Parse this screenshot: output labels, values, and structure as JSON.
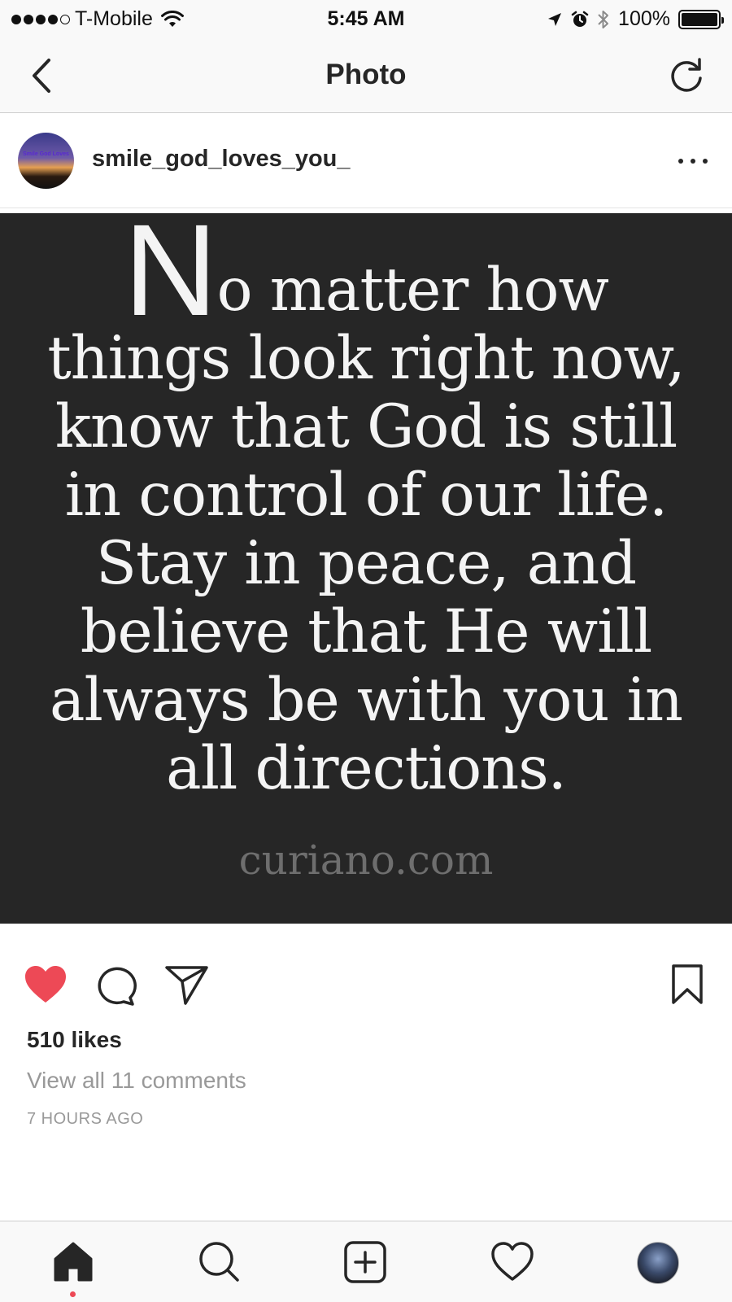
{
  "status_bar": {
    "carrier": "T-Mobile",
    "time": "5:45 AM",
    "battery_text": "100%",
    "battery_level": 1.0,
    "signal_bars_filled": 4,
    "signal_bars_total": 5,
    "icons": [
      "wifi-icon",
      "location-arrow-icon",
      "alarm-icon",
      "bluetooth-icon",
      "battery-icon"
    ]
  },
  "nav": {
    "title": "Photo",
    "back_icon": "chevron-left-icon",
    "refresh_icon": "refresh-icon"
  },
  "post": {
    "username": "smile_god_loves_you_",
    "avatar_text": "Smile God Loves",
    "quote": {
      "first_letter": "N",
      "lines": [
        "o matter how",
        "things look right now,",
        "know that God is still",
        "in control of our life.",
        "Stay in peace, and",
        "believe that He will",
        "always be with you in",
        "all directions."
      ],
      "watermark": "curiano.com"
    },
    "liked": true,
    "likes": "510 likes",
    "comments_link": "View all 11 comments",
    "timestamp": "7 HOURS AGO"
  },
  "colors": {
    "like_red": "#ed4956",
    "image_bg": "#262626",
    "muted_text": "#999999",
    "bar_bg": "#f9f9f9"
  },
  "tab_bar": {
    "tabs": [
      "home-icon",
      "search-icon",
      "add-post-icon",
      "activity-heart-icon",
      "profile-avatar"
    ],
    "active": "home-icon"
  }
}
